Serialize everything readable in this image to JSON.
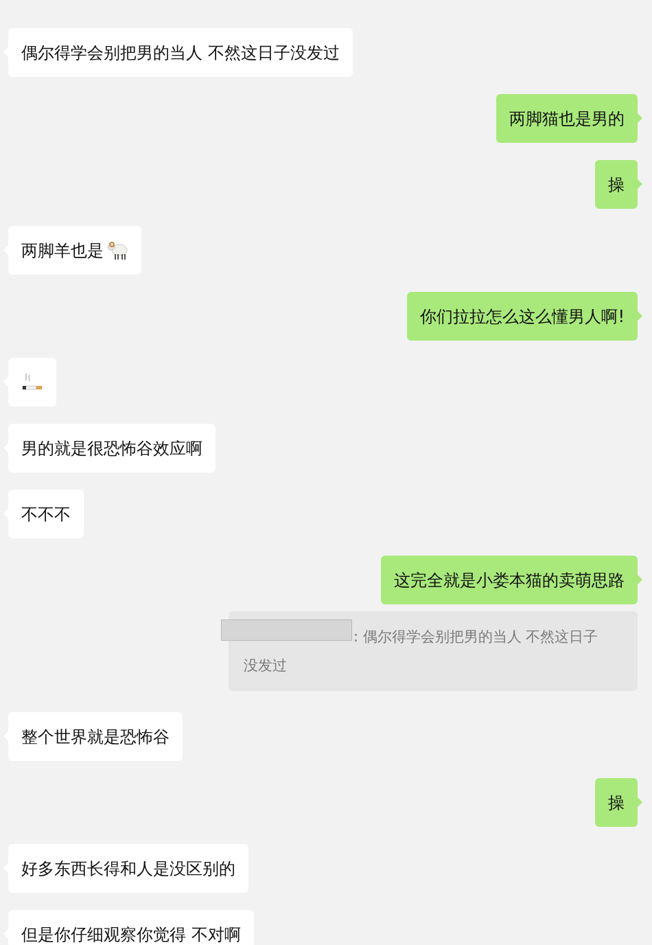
{
  "messages": [
    {
      "outgoing": false,
      "kind": "text",
      "text": "偶尔得学会别把男的当人 不然这日子没发过"
    },
    {
      "outgoing": true,
      "kind": "text",
      "text": "两脚猫也是男的"
    },
    {
      "outgoing": true,
      "kind": "text",
      "text": "操"
    },
    {
      "outgoing": false,
      "kind": "text_sheep",
      "text": "两脚羊也是"
    },
    {
      "outgoing": true,
      "kind": "text",
      "text": "你们拉拉怎么这么懂男人啊!"
    },
    {
      "outgoing": false,
      "kind": "cigarette"
    },
    {
      "outgoing": false,
      "kind": "text",
      "text": "男的就是很恐怖谷效应啊"
    },
    {
      "outgoing": false,
      "kind": "text",
      "text": "不不不"
    },
    {
      "outgoing": true,
      "kind": "text",
      "text": "这完全就是小娄本猫的卖萌思路"
    },
    {
      "outgoing": true,
      "kind": "quote",
      "redacted": true,
      "text": ": 偶尔得学会别把男的当人 不然这日子没发过"
    },
    {
      "outgoing": false,
      "kind": "text",
      "text": "整个世界就是恐怖谷"
    },
    {
      "outgoing": true,
      "kind": "text",
      "text": "操"
    },
    {
      "outgoing": false,
      "kind": "text",
      "text": "好多东西长得和人是没区别的"
    },
    {
      "outgoing": false,
      "kind": "text",
      "text": "但是你仔细观察你觉得 不对啊"
    }
  ]
}
